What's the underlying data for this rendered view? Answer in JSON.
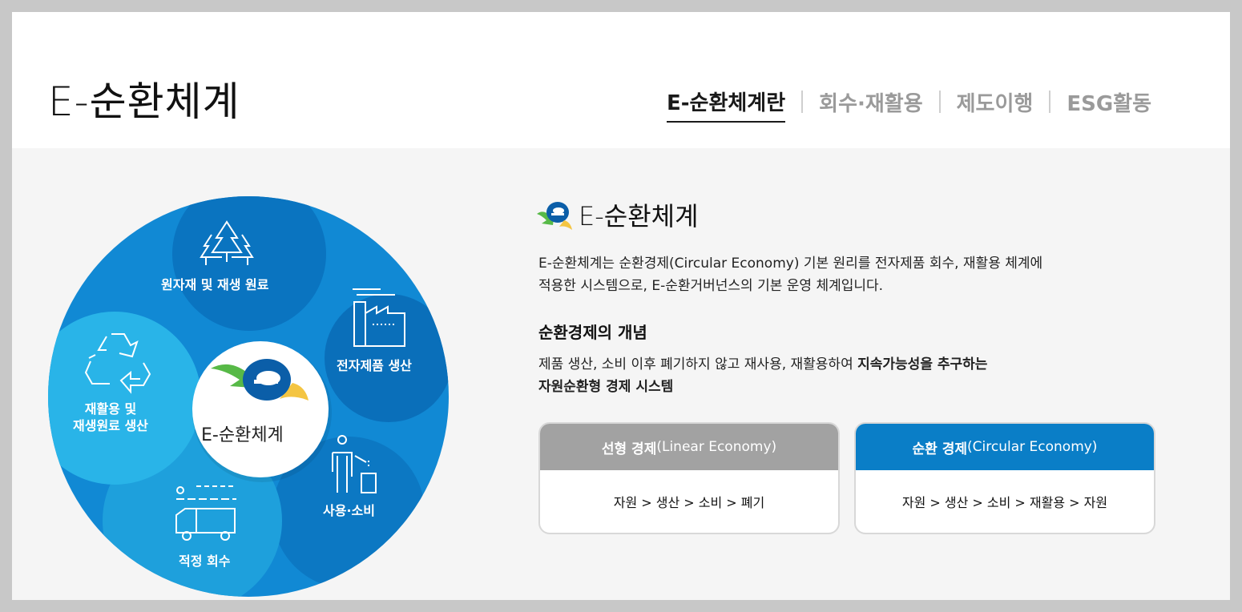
{
  "header": {
    "title": "E-순환체계",
    "tabs": [
      {
        "label": "E-순환체계란",
        "active": true
      },
      {
        "label": "회수·재활용",
        "active": false
      },
      {
        "label": "제도이행",
        "active": false
      },
      {
        "label": "ESG활동",
        "active": false
      }
    ]
  },
  "diagram": {
    "center_label": "E-순환체계",
    "segments": [
      {
        "label": "원자재 및 재생 원료",
        "icon": "trees-icon"
      },
      {
        "label": "전자제품 생산",
        "icon": "factory-icon"
      },
      {
        "label": "사용·소비",
        "icon": "person-trash-icon"
      },
      {
        "label": "적정 회수",
        "icon": "truck-icon"
      },
      {
        "label": "재활용 및",
        "label2": "재생원료 생산",
        "icon": "recycle-icon"
      }
    ],
    "colors": {
      "dark": "#0a6fba",
      "mid": "#1189d4",
      "light": "#29b4e8"
    }
  },
  "section": {
    "title": "E-순환체계",
    "desc_line1": "E-순환체계는 순환경제(Circular Economy) 기본 원리를 전자제품 회수, 재활용 체계에",
    "desc_line2": "적용한 시스템으로, E-순환거버넌스의 기본 운영 체계입니다.",
    "concept_title": "순환경제의 개념",
    "concept_line1_normal": "제품 생산, 소비 이후 폐기하지 않고 재사용, 재활용하여 ",
    "concept_line1_bold": "지속가능성을 추구하는",
    "concept_line2_bold": "자원순환형 경제 시스템"
  },
  "cards": {
    "linear": {
      "title_bold": "선형 경제",
      "title_rest": "(Linear Economy)",
      "flow": "자원 > 생산 > 소비 > 폐기",
      "header_color": "#a2a2a2"
    },
    "circular": {
      "title_bold": "순환 경제",
      "title_rest": "(Circular Economy)",
      "flow": "자원 > 생산 > 소비 > 재활용 > 자원",
      "header_color": "#0a7ec7"
    }
  }
}
